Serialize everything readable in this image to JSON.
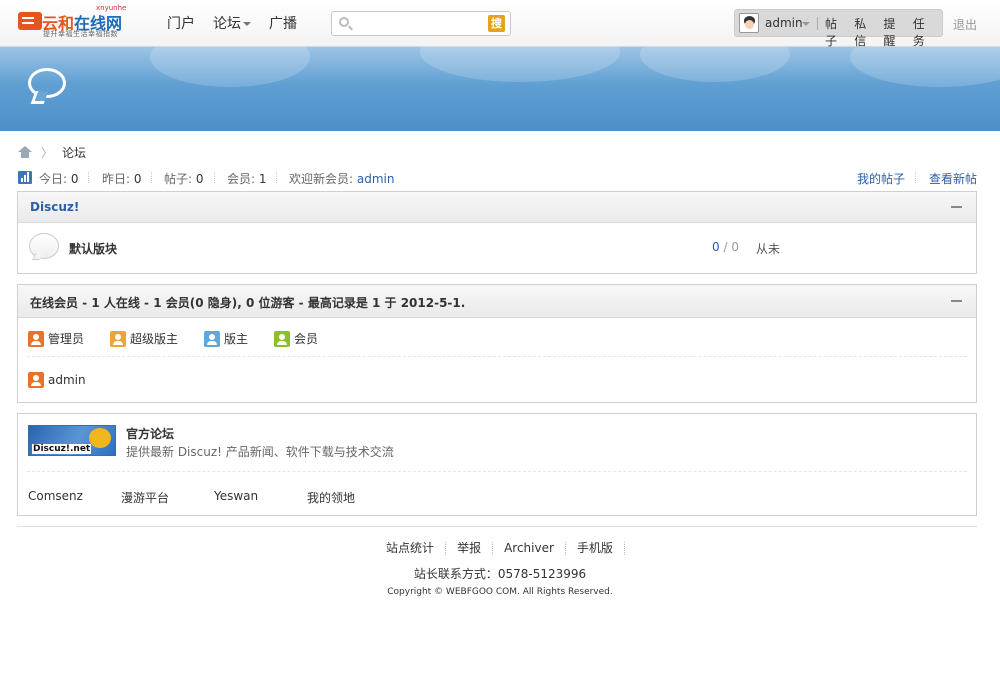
{
  "header": {
    "logo": {
      "name": "云和在线网",
      "part1": "云和",
      "part2": "在线网",
      "pinyin": "xnyunhe",
      "slogan": "提升幸福生活幸福指数"
    },
    "nav": [
      {
        "label": "门户"
      },
      {
        "label": "论坛",
        "has_dropdown": true
      },
      {
        "label": "广播"
      }
    ],
    "search": {
      "placeholder": "",
      "button_label": "搜"
    },
    "user": {
      "name": "admin",
      "links": [
        "帖子",
        "私信",
        "提醒",
        "任务"
      ]
    },
    "logout": "退出"
  },
  "breadcrumb": {
    "current": "论坛",
    "separator": "〉"
  },
  "stats": {
    "today_label": "今日: ",
    "today": "0",
    "yesterday_label": "昨日: ",
    "yesterday": "0",
    "posts_label": "帖子: ",
    "posts": "0",
    "members_label": "会员: ",
    "members": "1",
    "newest_label": "欢迎新会员: ",
    "newest_member": "admin",
    "my_posts": "我的帖子",
    "new_posts": "查看新帖"
  },
  "forum_category": {
    "title": "Discuz!",
    "forums": [
      {
        "name": "默认版块",
        "threads": "0",
        "sep": " / ",
        "posts": "0",
        "last_post": "从未"
      }
    ]
  },
  "online": {
    "title": "在线会员 - 1 人在线 - 1 会员(0 隐身), 0 位游客 - 最高记录是 1 于 2012-5-1.",
    "legend": [
      {
        "label": "管理员",
        "color": "#e8722a"
      },
      {
        "label": "超级版主",
        "color": "#f0a13a"
      },
      {
        "label": "版主",
        "color": "#5ea8e0"
      },
      {
        "label": "会员",
        "color": "#8cbf2a"
      }
    ],
    "users": [
      {
        "name": "admin",
        "color": "#e8722a"
      }
    ]
  },
  "links": {
    "featured": {
      "logo_text": "Discuz!.net",
      "title": "官方论坛",
      "desc": "提供最新 Discuz! 产品新闻、软件下载与技术交流"
    },
    "list": [
      "Comsenz",
      "漫游平台",
      "Yeswan",
      "我的领地"
    ]
  },
  "footer": {
    "links": [
      "站点统计",
      "举报",
      "Archiver",
      "手机版"
    ],
    "contact": "站长联系方式：0578-5123996",
    "copyright": "Copyright © WEBFGOO COM. All Rights Reserved."
  },
  "colors": {
    "link_blue": "#2b5fa5",
    "banner_blue": "#5f9fd3",
    "accent_orange": "#e8541e"
  }
}
